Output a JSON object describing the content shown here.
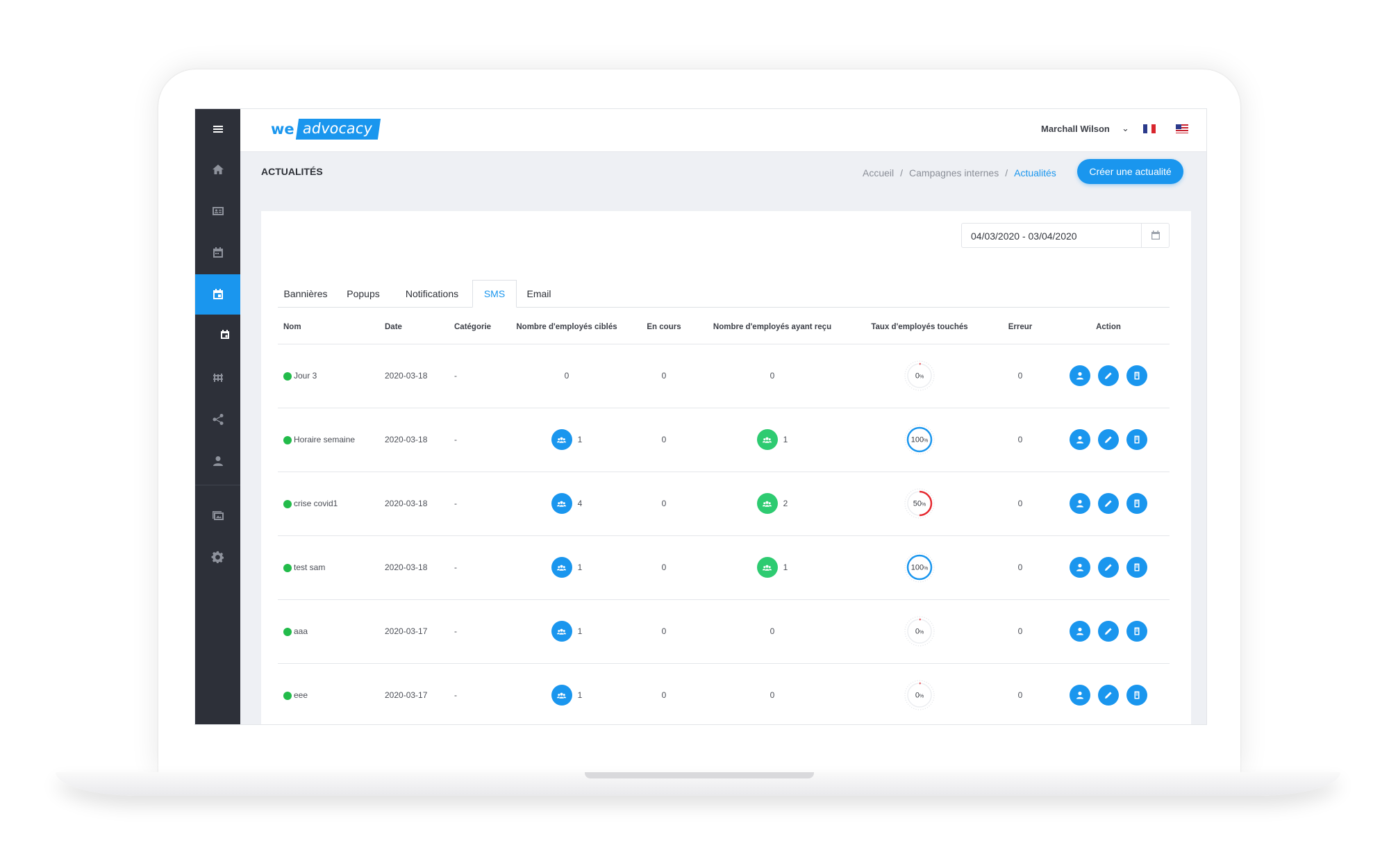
{
  "brand": {
    "we": "we",
    "advocacy": "advocacy"
  },
  "user": {
    "name": "Marchall Wilson",
    "languages": [
      "fr",
      "en"
    ]
  },
  "page": {
    "title": "ACTUALITÉS"
  },
  "breadcrumb": {
    "items": [
      "Accueil",
      "Campagnes internes",
      "Actualités"
    ],
    "separator": "/"
  },
  "create_button": "Créer une actualité",
  "date_range": "04/03/2020 - 03/04/2020",
  "tabs": [
    {
      "label": "Bannières",
      "active": false
    },
    {
      "label": "Popups",
      "active": false
    },
    {
      "label": "Notifications",
      "active": false
    },
    {
      "label": "SMS",
      "active": true
    },
    {
      "label": "Email",
      "active": false
    }
  ],
  "table": {
    "headers": [
      "Nom",
      "Date",
      "Catégorie",
      "Nombre d'employés ciblés",
      "En cours",
      "Nombre d'employés ayant reçu",
      "Taux d'employés touchés",
      "Erreur",
      "Action"
    ],
    "rows": [
      {
        "name": "Jour 3",
        "date": "2020-03-18",
        "category": "-",
        "targeted": "0",
        "in_progress": "0",
        "received": "0",
        "rate": "0",
        "error": "0"
      },
      {
        "name": "Horaire semaine",
        "date": "2020-03-18",
        "category": "-",
        "targeted": "1",
        "in_progress": "0",
        "received": "1",
        "rate": "100",
        "error": "0"
      },
      {
        "name": "crise covid1",
        "date": "2020-03-18",
        "category": "-",
        "targeted": "4",
        "in_progress": "0",
        "received": "2",
        "rate": "50",
        "error": "0"
      },
      {
        "name": "test sam",
        "date": "2020-03-18",
        "category": "-",
        "targeted": "1",
        "in_progress": "0",
        "received": "1",
        "rate": "100",
        "error": "0"
      },
      {
        "name": "aaa",
        "date": "2020-03-17",
        "category": "-",
        "targeted": "1",
        "in_progress": "0",
        "received": "0",
        "rate": "0",
        "error": "0"
      },
      {
        "name": "eee",
        "date": "2020-03-17",
        "category": "-",
        "targeted": "1",
        "in_progress": "0",
        "received": "0",
        "rate": "0",
        "error": "0"
      }
    ]
  },
  "percent_symbol": "%",
  "colors": {
    "accent": "#1a96ee",
    "success": "#2ecb71",
    "danger": "#f0454e",
    "sidebar": "#2d3039"
  },
  "sidebar_icons": [
    "menu-icon",
    "home-icon",
    "id-card-icon",
    "calendar-icon",
    "calendar-event-icon",
    "calendar-sub-icon",
    "team-icon",
    "share-icon",
    "user-icon",
    "gallery-icon",
    "settings-icon"
  ]
}
